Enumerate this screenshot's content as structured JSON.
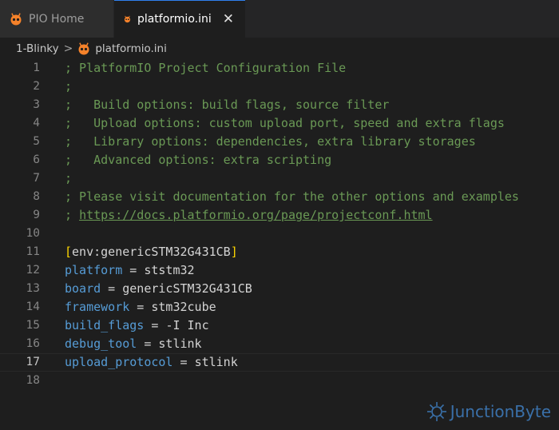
{
  "tabs": [
    {
      "label": "PIO Home",
      "active": false
    },
    {
      "label": "platformio.ini",
      "active": true
    }
  ],
  "tab_close_glyph": "✕",
  "breadcrumb": {
    "folder": "1-Blinky",
    "separator": ">",
    "file": "platformio.ini"
  },
  "editor": {
    "lines": [
      {
        "n": "1",
        "comment": "; PlatformIO Project Configuration File"
      },
      {
        "n": "2",
        "comment": ";"
      },
      {
        "n": "3",
        "comment": ";   Build options: build flags, source filter"
      },
      {
        "n": "4",
        "comment": ";   Upload options: custom upload port, speed and extra flags"
      },
      {
        "n": "5",
        "comment": ";   Library options: dependencies, extra library storages"
      },
      {
        "n": "6",
        "comment": ";   Advanced options: extra scripting"
      },
      {
        "n": "7",
        "comment": ";"
      },
      {
        "n": "8",
        "comment": "; Please visit documentation for the other options and examples"
      },
      {
        "n": "9",
        "comment_prefix": "; ",
        "link": "https://docs.platformio.org/page/projectconf.html"
      },
      {
        "n": "10"
      },
      {
        "n": "11",
        "section": "env:genericSTM32G431CB"
      },
      {
        "n": "12",
        "key": "platform",
        "value": "ststm32"
      },
      {
        "n": "13",
        "key": "board",
        "value": "genericSTM32G431CB"
      },
      {
        "n": "14",
        "key": "framework",
        "value": "stm32cube"
      },
      {
        "n": "15",
        "key": "build_flags",
        "value": "-I Inc"
      },
      {
        "n": "16",
        "key": "debug_tool",
        "value": "stlink"
      },
      {
        "n": "17",
        "key": "upload_protocol",
        "value": "stlink",
        "current": true
      },
      {
        "n": "18"
      }
    ]
  },
  "watermark": {
    "text": "JunctionByte"
  },
  "colors": {
    "accent": "#2f80ed",
    "comment": "#6a9955",
    "key": "#569cd6",
    "bracket": "#ffd700",
    "pio_icon": "#f5822a"
  },
  "icons": {
    "tab_icon": "platformio-icon",
    "breadcrumb_icon": "platformio-icon",
    "watermark_icon": "junctionbyte-logo-icon"
  }
}
